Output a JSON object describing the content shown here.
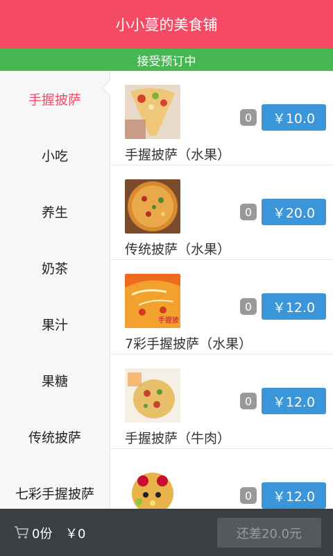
{
  "header": {
    "title": "小小蔓的美食铺"
  },
  "status": {
    "text": "接受预订中"
  },
  "sidebar": {
    "items": [
      {
        "label": "手握披萨"
      },
      {
        "label": "小吃"
      },
      {
        "label": "养生"
      },
      {
        "label": "奶茶"
      },
      {
        "label": "果汁"
      },
      {
        "label": "果糖"
      },
      {
        "label": "传统披萨"
      },
      {
        "label": "七彩手握披萨"
      }
    ]
  },
  "products": [
    {
      "name": "手握披萨（水果）",
      "qty": "0",
      "price": "￥10.0",
      "image": "hand-pizza-fruit"
    },
    {
      "name": "传统披萨（水果）",
      "qty": "0",
      "price": "￥20.0",
      "image": "traditional-pizza"
    },
    {
      "name": "7彩手握披萨（水果）",
      "qty": "0",
      "price": "￥12.0",
      "image": "rainbow-pizza",
      "image_text": "手握披"
    },
    {
      "name": "手握披萨（牛肉）",
      "qty": "0",
      "price": "￥12.0",
      "image": "beef-pizza"
    },
    {
      "name": "",
      "qty": "0",
      "price": "￥12.0",
      "image": "fruit-pizza"
    }
  ],
  "footer": {
    "cart_count": "0份",
    "total": "￥0",
    "checkout_label": "还差20.0元"
  },
  "colors": {
    "brand": "#f54a64",
    "status": "#47b752",
    "price_button": "#3a96d8",
    "footer": "#3b3f44"
  }
}
